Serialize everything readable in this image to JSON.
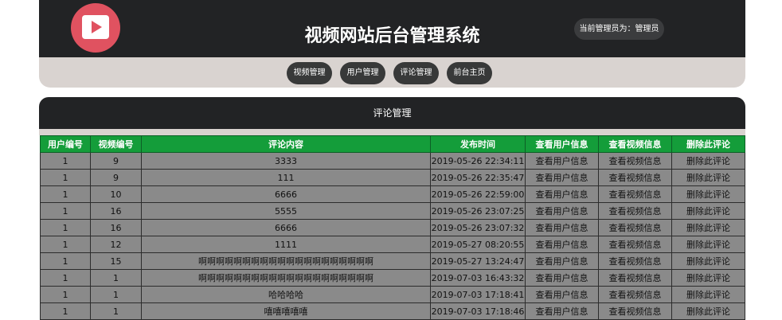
{
  "header": {
    "logo_icon": "video-play-icon",
    "title": "视频网站后台管理系统",
    "admin_label": "当前管理员为：管理员"
  },
  "nav": {
    "items": [
      {
        "label": "视频管理"
      },
      {
        "label": "用户管理"
      },
      {
        "label": "评论管理"
      },
      {
        "label": "前台主页"
      }
    ]
  },
  "panel": {
    "title": "评论管理"
  },
  "table": {
    "columns": [
      "用户编号",
      "视频编号",
      "评论内容",
      "发布时间",
      "查看用户信息",
      "查看视频信息",
      "删除此评论"
    ],
    "rows": [
      {
        "user_id": "1",
        "video_id": "9",
        "content": "3333",
        "time": "2019-05-26 22:34:11",
        "view_user": "查看用户信息",
        "view_video": "查看视频信息",
        "delete": "删除此评论"
      },
      {
        "user_id": "1",
        "video_id": "9",
        "content": "111",
        "time": "2019-05-26 22:35:47",
        "view_user": "查看用户信息",
        "view_video": "查看视频信息",
        "delete": "删除此评论"
      },
      {
        "user_id": "1",
        "video_id": "10",
        "content": "6666",
        "time": "2019-05-26 22:59:00",
        "view_user": "查看用户信息",
        "view_video": "查看视频信息",
        "delete": "删除此评论"
      },
      {
        "user_id": "1",
        "video_id": "16",
        "content": "5555",
        "time": "2019-05-26 23:07:25",
        "view_user": "查看用户信息",
        "view_video": "查看视频信息",
        "delete": "删除此评论"
      },
      {
        "user_id": "1",
        "video_id": "16",
        "content": "6666",
        "time": "2019-05-26 23:07:32",
        "view_user": "查看用户信息",
        "view_video": "查看视频信息",
        "delete": "删除此评论"
      },
      {
        "user_id": "1",
        "video_id": "12",
        "content": "1111",
        "time": "2019-05-27 08:20:55",
        "view_user": "查看用户信息",
        "view_video": "查看视频信息",
        "delete": "删除此评论"
      },
      {
        "user_id": "1",
        "video_id": "15",
        "content": "啊啊啊啊啊啊啊啊啊啊啊啊啊啊啊啊啊啊啊啊",
        "time": "2019-05-27 13:24:47",
        "view_user": "查看用户信息",
        "view_video": "查看视频信息",
        "delete": "删除此评论"
      },
      {
        "user_id": "1",
        "video_id": "1",
        "content": "啊啊啊啊啊啊啊啊啊啊啊啊啊啊啊啊啊啊啊啊",
        "time": "2019-07-03 16:43:32",
        "view_user": "查看用户信息",
        "view_video": "查看视频信息",
        "delete": "删除此评论"
      },
      {
        "user_id": "1",
        "video_id": "1",
        "content": "哈哈哈哈",
        "time": "2019-07-03 17:18:41",
        "view_user": "查看用户信息",
        "view_video": "查看视频信息",
        "delete": "删除此评论"
      },
      {
        "user_id": "1",
        "video_id": "1",
        "content": "嘻嘻嘻嘻嘻",
        "time": "2019-07-03 17:18:46",
        "view_user": "查看用户信息",
        "view_video": "查看视频信息",
        "delete": "删除此评论"
      }
    ]
  }
}
